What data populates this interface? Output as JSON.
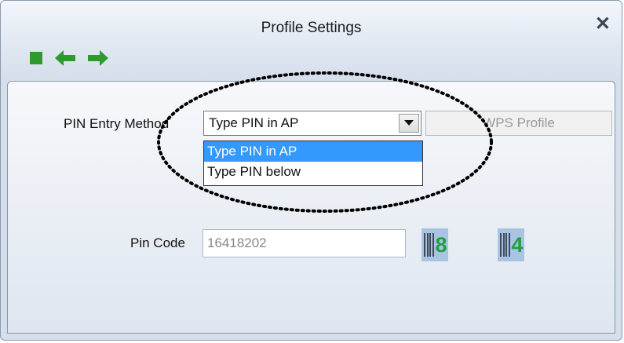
{
  "window": {
    "title": "Profile Settings",
    "close_label": "✕"
  },
  "toolbar": {
    "buttons": [
      {
        "icon": "stop-square-icon",
        "color": "#2e9a2e"
      },
      {
        "icon": "back-arrow-icon",
        "color": "#2e9a2e"
      },
      {
        "icon": "forward-arrow-icon",
        "color": "#2e9a2e"
      }
    ]
  },
  "form": {
    "pin_entry_method_label": "PIN Entry Method",
    "pin_entry_method_value": "Type PIN in AP",
    "options": [
      "Type PIN in AP",
      "Type PIN below"
    ],
    "selected_option_index": 0,
    "wps_profile_label": "WPS Profile",
    "pin_code_label": "Pin Code",
    "pin_code_value": "16418202",
    "pin_generate_icons": [
      {
        "icon": "barcode-8-icon",
        "digit": "8"
      },
      {
        "icon": "barcode-4-icon",
        "digit": "4"
      }
    ]
  },
  "colors": {
    "selection": "#3399ff",
    "accent_green": "#2e9a2e",
    "disabled_text": "#9a9a9a"
  }
}
